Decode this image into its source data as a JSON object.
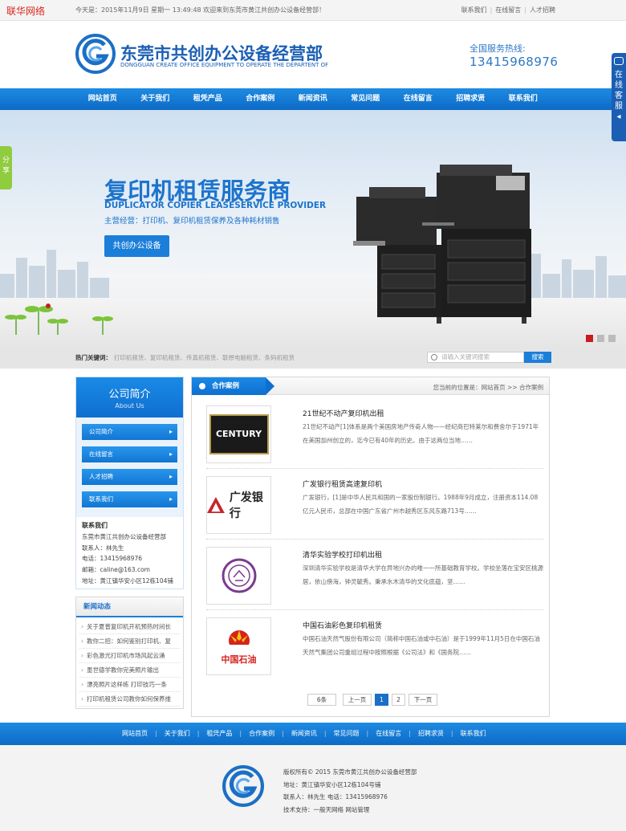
{
  "topbar": {
    "watermark": "联华网络",
    "welcome": "今天是：2015年11月9日 星期一 13:49:48 欢迎来到东莞市黄江共创办公设备经营部！",
    "links": [
      "联系我们",
      "在线留言",
      "人才招聘"
    ]
  },
  "header": {
    "company": "东莞市共创办公设备经营部",
    "company_en": "DONGGUAN CREATE OFFICE EQUIPMENT TO OPERATE THE DEPARTENT OF",
    "hotline_label": "全国服务热线:",
    "hotline": "13415968976"
  },
  "nav": [
    "网站首页",
    "关于我们",
    "租凭产品",
    "合作案例",
    "新闻资讯",
    "常见问题",
    "在线留言",
    "招聘求贤",
    "联系我们"
  ],
  "banner": {
    "title": "复印机租赁服务商",
    "subtitle_en": "DUPLICATOR COPIER LEASESERVICE PROVIDER",
    "business": "主营经营：打印机、复印机租赁保养及各种耗材销售",
    "button": "共创办公设备"
  },
  "hot": {
    "label": "热门关键词：",
    "keywords": "打印机租赁、复印机租赁、传真机租赁、联想电脑租赁、条码机租赁",
    "search_placeholder": "请输入关键词搜索",
    "search_button": "搜索"
  },
  "about": {
    "title": "公司简介",
    "title_en": "About Us",
    "menu": [
      "公司简介",
      "在线留言",
      "人才招聘",
      "联系我们"
    ],
    "contact_title": "联系我们",
    "contact_lines": [
      "东莞市黄江共创办公设备经营部",
      "联系人：林先生",
      "电话：13415968976",
      "邮箱：caline@163.com",
      "地址：黄江镇华安小区12栋104铺"
    ]
  },
  "news": {
    "title": "新闻动态",
    "items": [
      "关于夏普复印机开机预热时间长",
      "教你二招：如何鉴别打印机、复",
      "彩色激光打印机市场风起云涌",
      "墨世德学教你完美照片输出",
      "漂亮照片这样练 打印技巧一条",
      "打印机租赁公司教你如何保养维"
    ]
  },
  "main": {
    "tab": "合作案例",
    "crumb": "您当前的位置是：网站首页 >> 合作案例",
    "items": [
      {
        "title": "21世纪不动产复印机出租",
        "desc": "21世纪不动产[1]体系是两个美国房地产传奇人物——经纪商巴特莱尔和费舍尔于1971年在美国加州创立的，迄今已有40年的历史。由于这两位当地……"
      },
      {
        "title": "广发银行租赁高速复印机",
        "desc": "广发银行，[1]是中华人民共和国的一家股份制银行。1988年9月成立，注册资本114.08亿元人民币，总部在中国广东省广州市越秀区东风东路713号……"
      },
      {
        "title": "清华实验学校打印机出租",
        "desc": "深圳清华实验学校是清华大学在异地兴办的唯一一所基础教育学校。学校坐落在宝安区桃源居，依山傍海，钟灵毓秀。秉承水木清华的文化底蕴，坚……"
      },
      {
        "title": "中国石油彩色复印机租赁",
        "desc": "中国石油天然气股份有限公司（简称中国石油或中石油）是于1999年11月5日在中国石油天然气集团公司重组过程中按照根据《公司法》和《国务院……"
      }
    ],
    "logo_century": "CENTURY 21",
    "logo_cgb": "广发银行",
    "logo_petro": "中国石油",
    "pager": [
      "6条",
      "上一页",
      "1",
      "2",
      "下一页"
    ]
  },
  "footer_nav": [
    "网站首页",
    "关于我们",
    "租凭产品",
    "合作案例",
    "新闻资讯",
    "常见问题",
    "在线留言",
    "招聘求贤",
    "联系我们"
  ],
  "footer": {
    "lines": [
      "版权所有© 2015 东莞市黄江共创办公设备经营部",
      "地址：黄江镇华安小区12栋104号铺",
      "联系人：林先生 电话：13415968976",
      "技术支持：一般天网络 网站管理"
    ]
  },
  "side": {
    "share": "分享",
    "kefu": [
      "在",
      "线",
      "客",
      "服",
      "◂"
    ]
  },
  "colors": {
    "brand": "#1b6fc6",
    "nav": "#0d6ac6",
    "accent_red": "#c81c1c",
    "share_green": "#8fcc3e"
  }
}
